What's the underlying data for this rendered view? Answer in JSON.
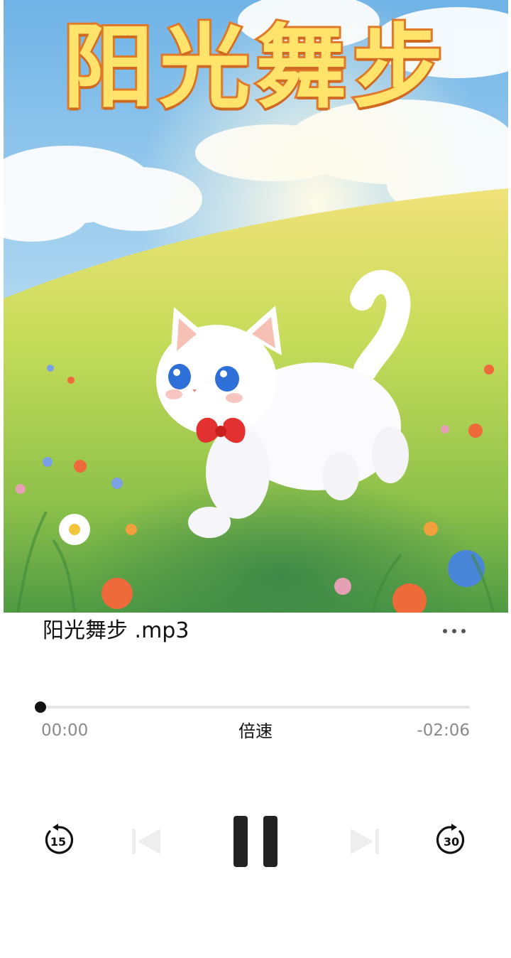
{
  "cover": {
    "title": "阳光舞步",
    "alt": "album-cover"
  },
  "track": {
    "title": "阳光舞步 .mp3",
    "more_icon": "more-horizontal-icon"
  },
  "progress": {
    "fraction": 0.0,
    "elapsed": "00:00",
    "remaining": "-02:06",
    "speed_label": "倍速"
  },
  "controls": {
    "skip_back_seconds": "15",
    "skip_forward_seconds": "30",
    "skip_back_icon": "rewind-15-icon",
    "prev_icon": "previous-track-icon",
    "play_pause_icon": "pause-icon",
    "next_icon": "next-track-icon",
    "skip_forward_icon": "forward-30-icon",
    "prev_enabled": false,
    "next_enabled": false
  },
  "colors": {
    "text": "#111111",
    "muted": "#8a8a8a",
    "track": "#e6e6e6",
    "disabled": "#eeeeee"
  }
}
